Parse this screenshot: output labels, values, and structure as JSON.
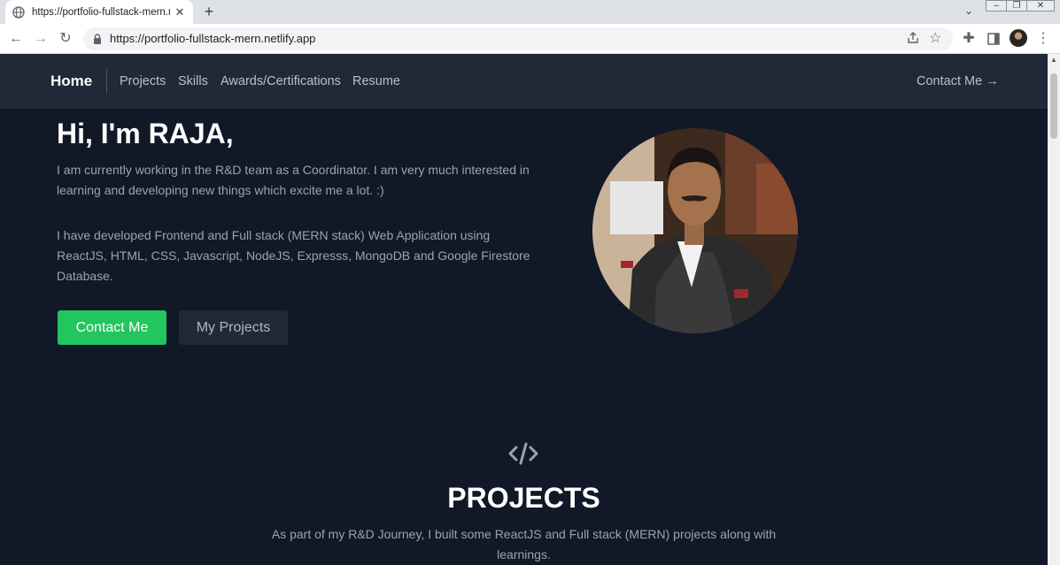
{
  "browser": {
    "tab_title": "https://portfolio-fullstack-mern.n",
    "url": "https://portfolio-fullstack-mern.netlify.app"
  },
  "navbar": {
    "home": "Home",
    "links": [
      "Projects",
      "Skills",
      "Awards/Certifications",
      "Resume"
    ],
    "contact": "Contact Me"
  },
  "hero": {
    "title": "Hi, I'm RAJA,",
    "para1": "I am currently working in the R&D team as a Coordinator. I am very much interested in learning and developing new things which excite me a lot. :)",
    "para2": "I have developed Frontend and Full stack (MERN stack) Web Application using ReactJS, HTML, CSS, Javascript, NodeJS, Expresss, MongoDB and Google Firestore Database.",
    "btn_contact": "Contact Me",
    "btn_projects": "My Projects"
  },
  "projects": {
    "title": "PROJECTS",
    "description": "As part of my R&D Journey, I built some ReactJS and Full stack (MERN) projects along with learnings."
  },
  "colors": {
    "page_bg": "#111827",
    "navbar_bg": "#1f2937",
    "accent_green": "#22c55e",
    "text_muted": "#9ca3af"
  },
  "icons": [
    "globe-icon",
    "close-icon",
    "plus-icon",
    "back-icon",
    "forward-icon",
    "reload-icon",
    "lock-icon",
    "share-icon",
    "star-icon",
    "extensions-icon",
    "sidepanel-icon",
    "menu-icon",
    "arrow-right-icon",
    "code-icon"
  ]
}
